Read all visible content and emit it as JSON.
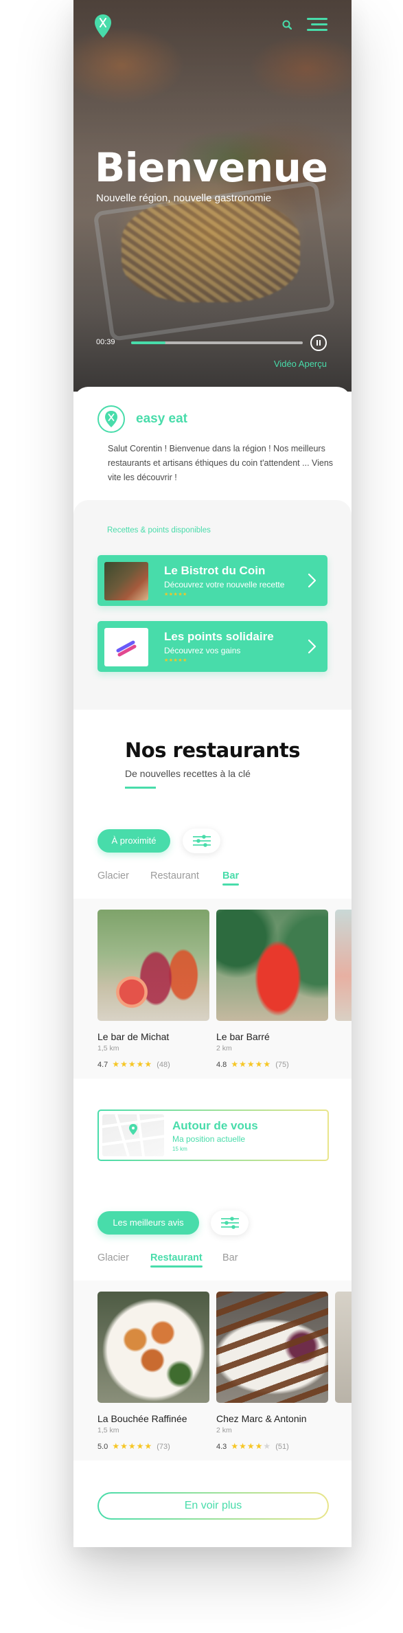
{
  "colors": {
    "accent": "#48dcaa",
    "star": "#f6c625",
    "gradient_end": "#e9e58a"
  },
  "hero": {
    "title": "Bienvenue",
    "subtitle": "Nouvelle région, nouvelle gastronomie",
    "time": "00:39",
    "progress": 0.2,
    "video_link": "Vidéo Aperçu"
  },
  "intro": {
    "brand": "easy eat",
    "text": "Salut Corentin ! Bienvenue dans la région ! Nos meilleurs restaurants et artisans éthiques du coin t'attendent ... Viens vite les découvrir !"
  },
  "recipes": {
    "label": "Recettes & points disponibles",
    "cards": [
      {
        "title": "Le Bistrot du Coin",
        "subtitle": "Découvrez votre nouvelle recette",
        "stars": "★★★★★"
      },
      {
        "title": "Les points solidaire",
        "subtitle": "Découvrez vos gains",
        "stars": "★★★★★"
      }
    ]
  },
  "restaurants": {
    "title": "Nos restaurants",
    "subtitle": "De nouvelles recettes à la clé"
  },
  "section1": {
    "pill": "À proximité",
    "tabs": [
      "Glacier",
      "Restaurant",
      "Bar"
    ],
    "active_tab": "Bar",
    "cards": [
      {
        "name": "Le bar de Michat",
        "distance": "1,5 km",
        "rating": "4.7",
        "rating_value": 4.7,
        "count": "(48)"
      },
      {
        "name": "Le bar Barré",
        "distance": "2 km",
        "rating": "4.8",
        "rating_value": 4.8,
        "count": "(75)"
      }
    ]
  },
  "around": {
    "title": "Autour de vous",
    "subtitle": "Ma position actuelle",
    "distance": "15 km"
  },
  "section2": {
    "pill": "Les meilleurs avis",
    "tabs": [
      "Glacier",
      "Restaurant",
      "Bar"
    ],
    "active_tab": "Restaurant",
    "cards": [
      {
        "name": "La Bouchée Raffinée",
        "distance": "1,5 km",
        "rating": "5.0",
        "rating_value": 5.0,
        "count": "(73)"
      },
      {
        "name": "Chez Marc & Antonin",
        "distance": "2 km",
        "rating": "4.3",
        "rating_value": 4.3,
        "count": "(51)"
      }
    ]
  },
  "cta": {
    "label": "En voir plus"
  }
}
